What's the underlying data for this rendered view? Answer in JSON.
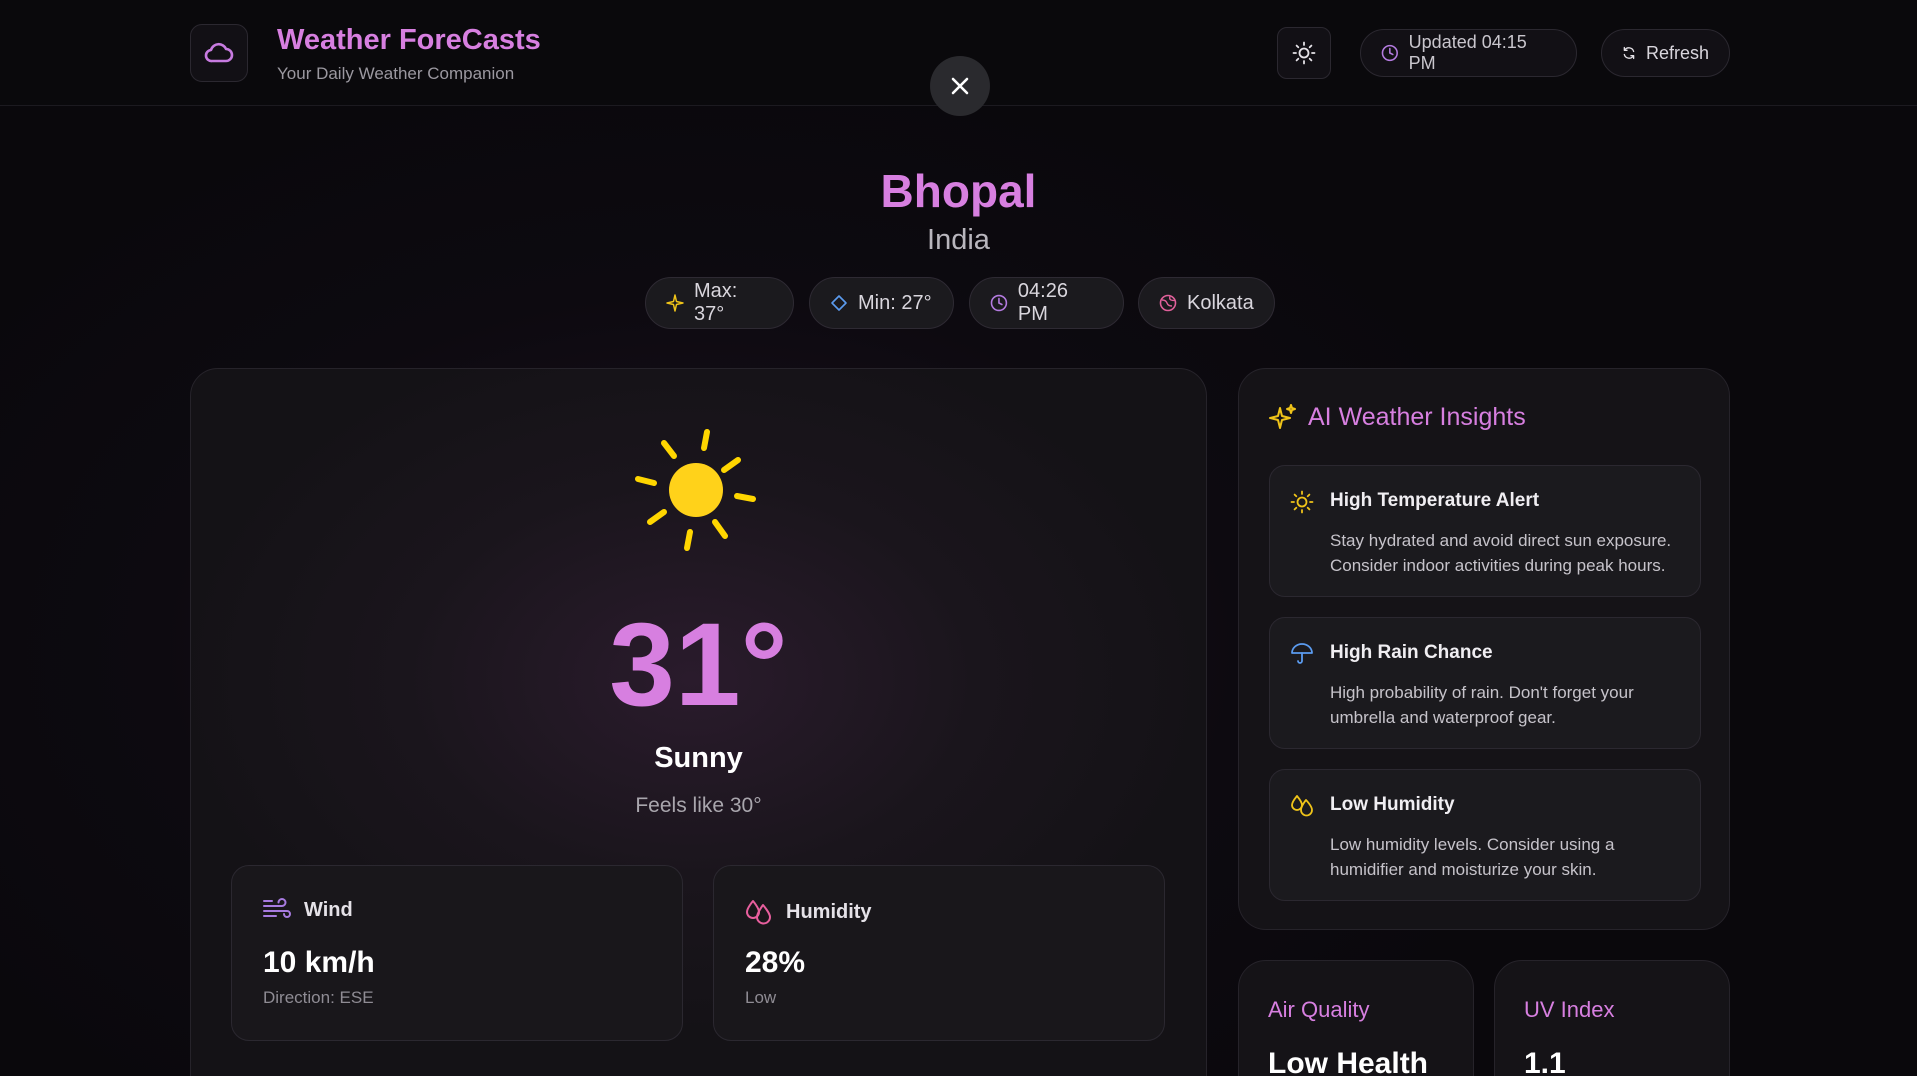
{
  "header": {
    "app_title": "Weather ForeCasts",
    "app_subtitle": "Your Daily Weather Companion",
    "updated_label": "Updated 04:15 PM",
    "refresh_label": "Refresh"
  },
  "location": {
    "city": "Bhopal",
    "country": "India",
    "chips": {
      "max": "Max: 37°",
      "min": "Min: 27°",
      "time": "04:26 PM",
      "timezone": "Kolkata"
    }
  },
  "current": {
    "temperature": "31°",
    "condition": "Sunny",
    "feels_like": "Feels like 30°",
    "wind": {
      "label": "Wind",
      "value": "10 km/h",
      "sub": "Direction: ESE"
    },
    "humidity": {
      "label": "Humidity",
      "value": "28%",
      "sub": "Low"
    }
  },
  "insights": {
    "title": "AI Weather Insights",
    "items": [
      {
        "title": "High Temperature Alert",
        "text": "Stay hydrated and avoid direct sun exposure. Consider indoor activities during peak hours.",
        "icon": "sun-icon"
      },
      {
        "title": "High Rain Chance",
        "text": "High probability of rain. Don't forget your umbrella and waterproof gear.",
        "icon": "umbrella-icon"
      },
      {
        "title": "Low Humidity",
        "text": "Low humidity levels. Consider using a humidifier and moisturize your skin.",
        "icon": "droplets-icon"
      }
    ]
  },
  "air_quality": {
    "title": "Air Quality",
    "value": "Low Health"
  },
  "uv_index": {
    "title": "UV Index",
    "value": "1.1"
  },
  "colors": {
    "accent": "#d77fe0",
    "sun": "#ffd600",
    "background": "#0b080e"
  }
}
